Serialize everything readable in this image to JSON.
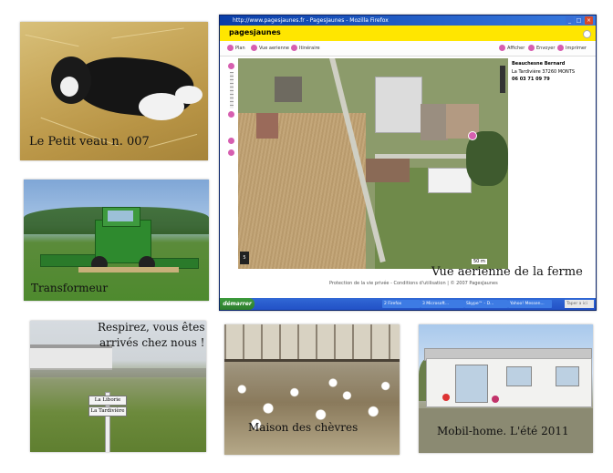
{
  "captions": {
    "calf": "Le Petit veau   n. 007",
    "tractor": "Transformeur",
    "farm": "Vue aerienne de la ferme",
    "welcome_line1": "Respirez, vous êtes",
    "welcome_line2": "arrivés chez nous !",
    "goats": "Maison des chèvres",
    "mobilhome": "Mobil-home. L'été 2011"
  },
  "browser": {
    "title": "http://www.pagesjaunes.fr - PagesJaunes - Mozilla Firefox",
    "logo": "pagesjaunes",
    "tools_left": [
      "Plan",
      "Vue aerienne",
      "Itinéraire"
    ],
    "tools_right": [
      "Afficher",
      "Envoyer",
      "Imprimer"
    ],
    "listing_name": "Beauchesne Bernard",
    "listing_address": "La Tardivière 37260 MONTS",
    "listing_phone": "06 03 71 09 79",
    "scale": "50 m",
    "footer": "Protection de la vie privée - Conditions d'utilisation | © 2007 PagesJaunes",
    "start": "démarrer",
    "taskbar_items": [
      "2 Firefox",
      "3 Microsoft...",
      "Skype™ - D...",
      "Yahoo! Messen..."
    ],
    "clock": "Taper a ici"
  },
  "signs": [
    "La Liborie",
    "La Tardivière"
  ],
  "colors": {
    "title_bar": "#0a3ea8",
    "yellow": "#ffe600",
    "pink": "#d65fb0",
    "taskbar": "#2251c6"
  }
}
